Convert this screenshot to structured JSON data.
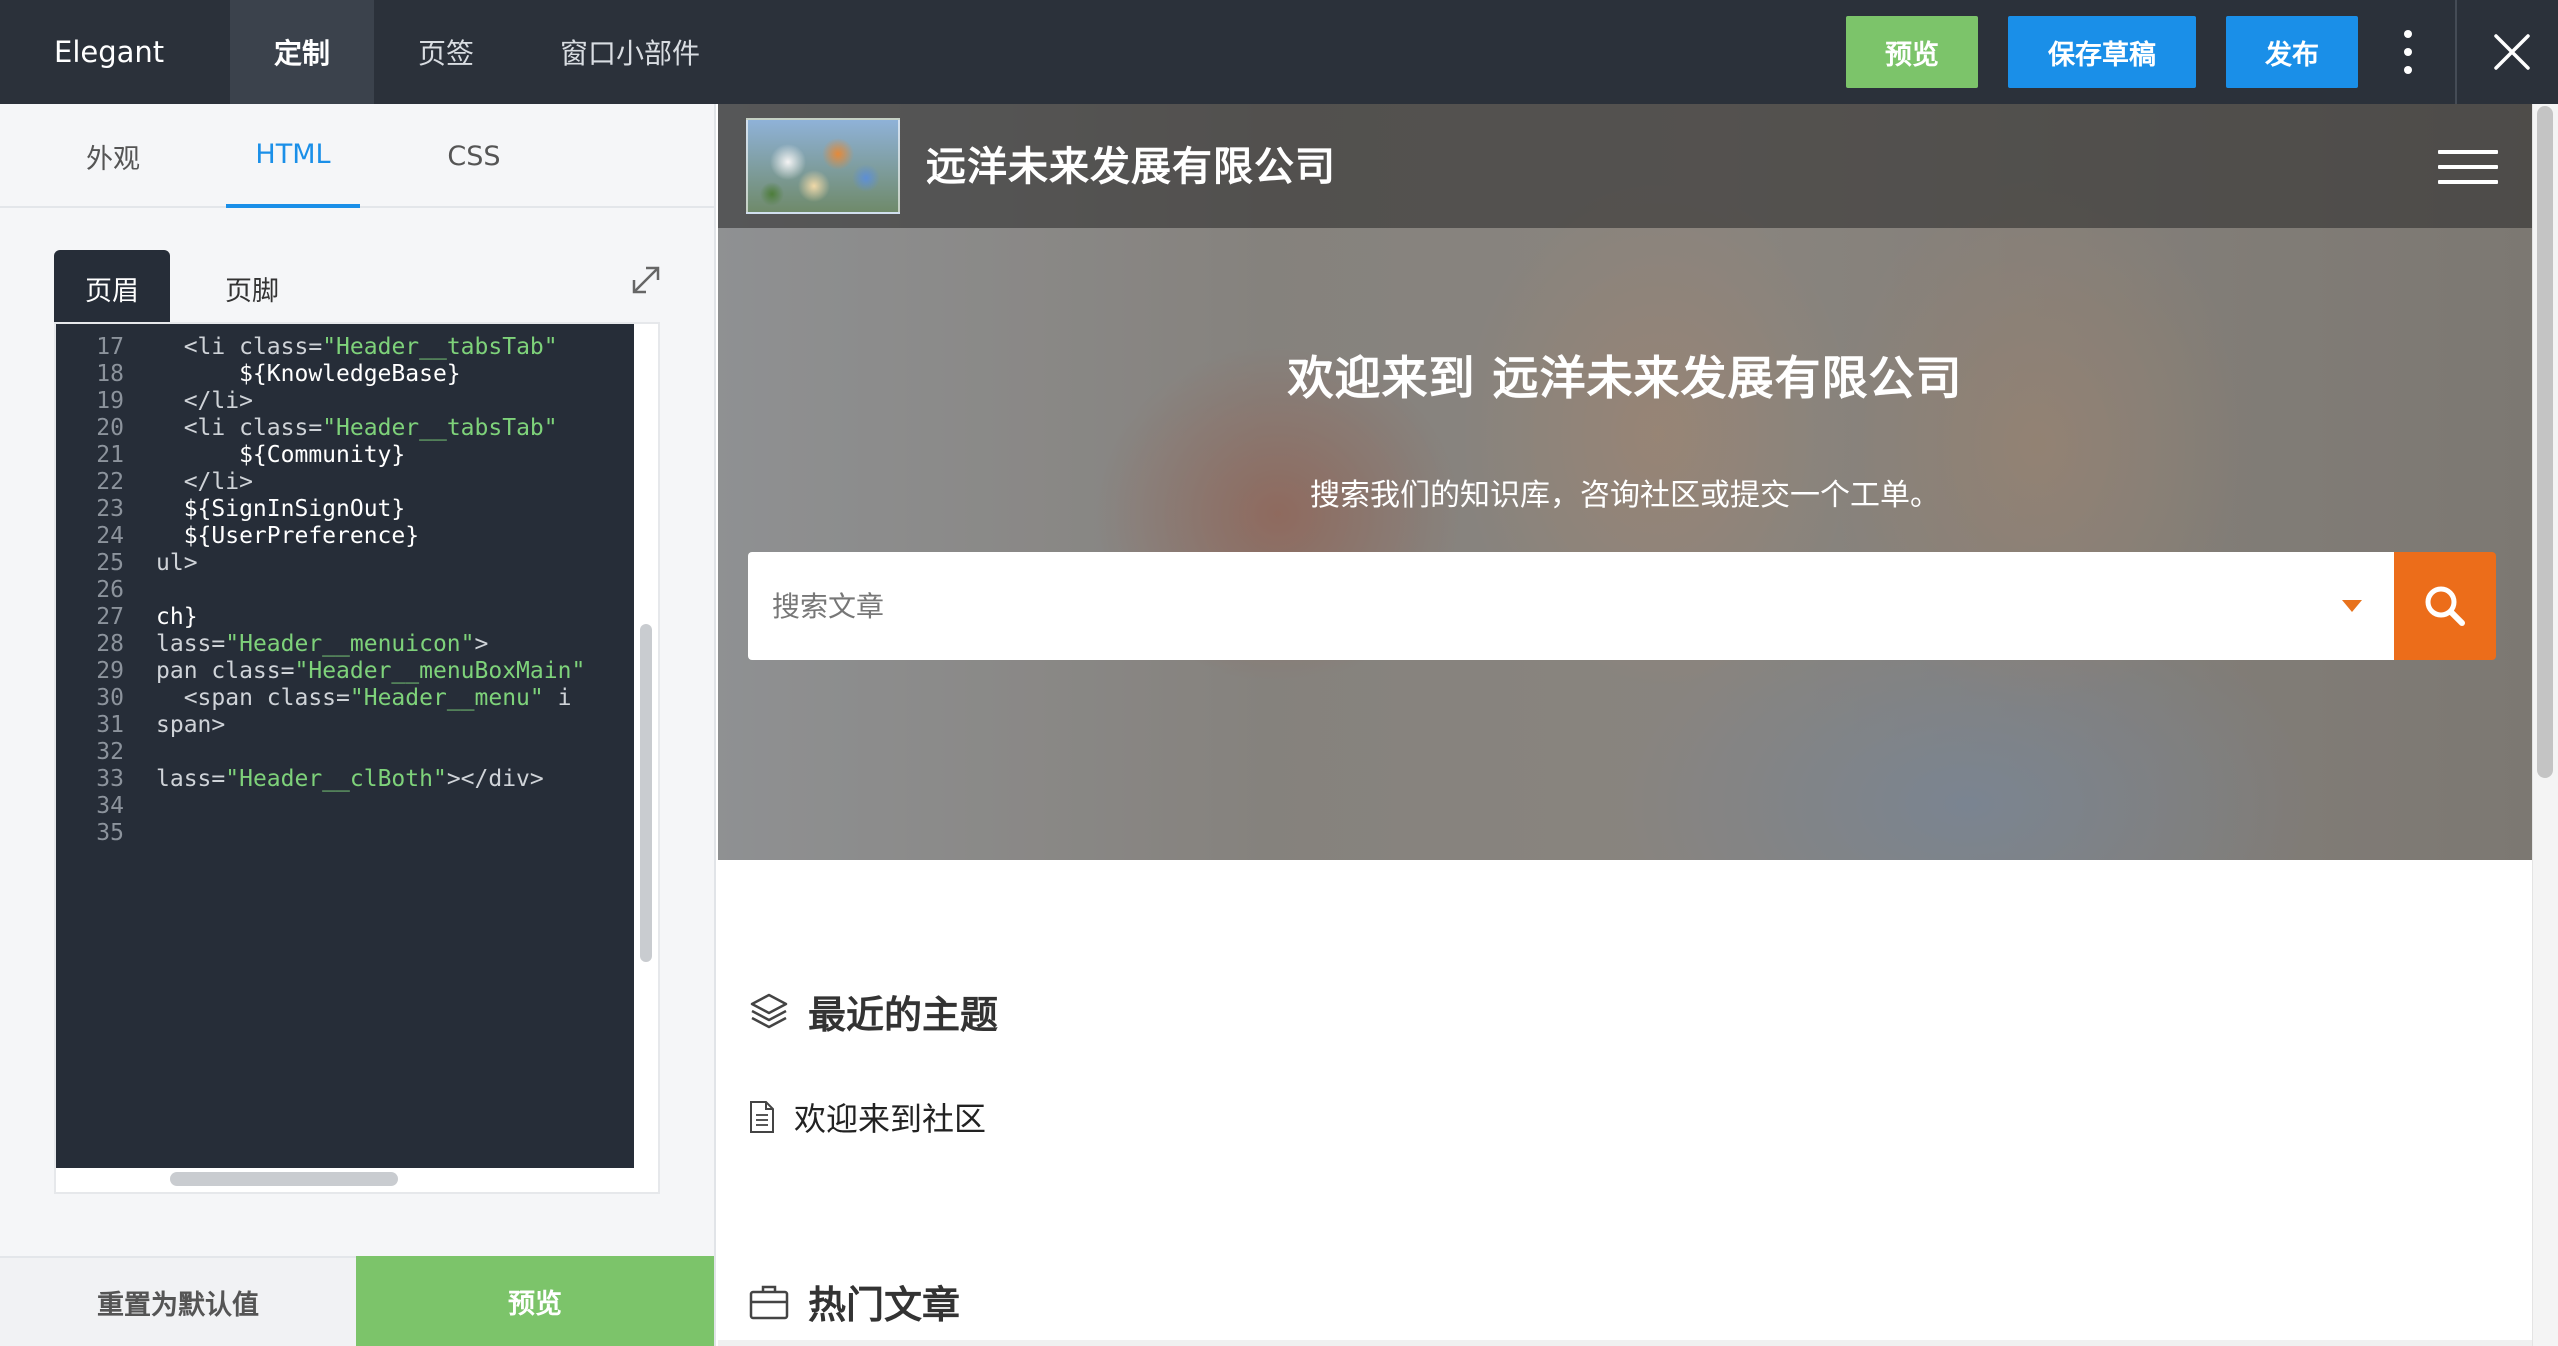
{
  "app": {
    "brand": "Elegant",
    "top_tabs": {
      "customize": "定制",
      "page": "页签",
      "widget": "窗口小部件"
    },
    "top_buttons": {
      "preview": "预览",
      "save_draft": "保存草稿",
      "publish": "发布"
    },
    "icons": {
      "more": "more-vertical-icon",
      "close": "close-icon"
    }
  },
  "left_panel": {
    "subtabs": {
      "look": "外观",
      "html": "HTML",
      "css": "CSS"
    },
    "active_subtab": "HTML",
    "editor_tabs": {
      "header": "页眉",
      "footer": "页脚"
    },
    "active_editor_tab": "页眉",
    "line_numbers": [
      "17",
      "18",
      "19",
      "20",
      "21",
      "22",
      "23",
      "24",
      "25",
      "26",
      "27",
      "28",
      "29",
      "30",
      "31",
      "32",
      "33",
      "34",
      "35"
    ],
    "buttons": {
      "reset": "重置为默认值",
      "preview": "预览"
    }
  },
  "preview": {
    "company_name": "远洋未来发展有限公司",
    "hero_title": "欢迎来到 远洋未来发展有限公司",
    "hero_subtitle": "搜索我们的知识库，咨询社区或提交一个工单。",
    "search_placeholder": "搜索文章",
    "recent_topics_title": "最近的主题",
    "recent_topics": [
      "欢迎来到社区"
    ],
    "popular_articles_title": "热门文章"
  },
  "colors": {
    "topbar": "#2b313a",
    "accent_blue": "#1a8fe8",
    "preview_green": "#7cc46a",
    "search_orange": "#ec6d1a",
    "editor_bg": "#262d38",
    "code_string": "#7ed27a"
  }
}
